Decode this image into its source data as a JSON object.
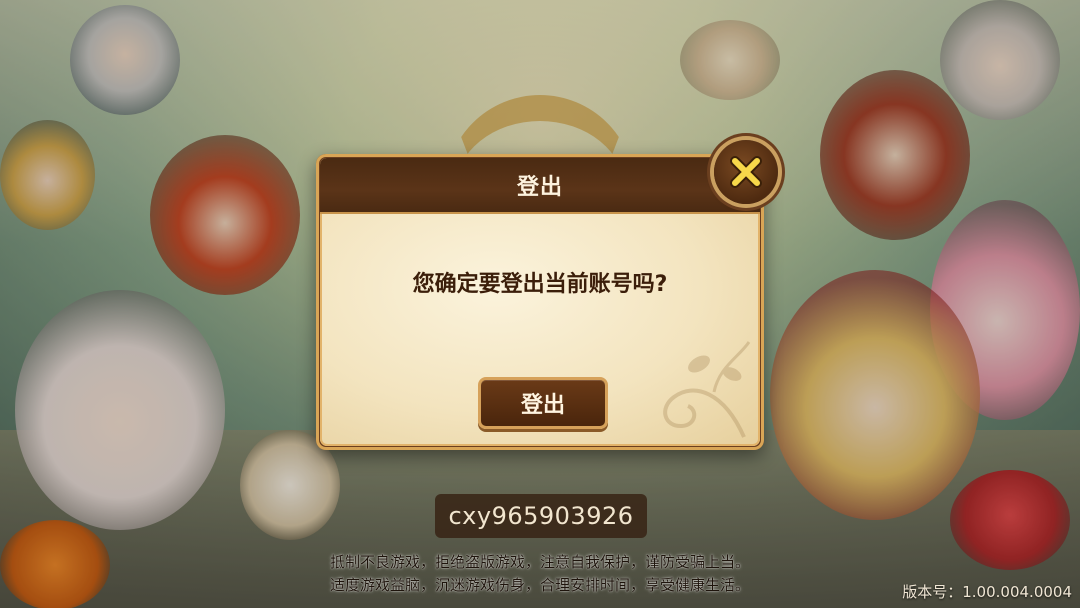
{
  "dialog": {
    "title": "登出",
    "message": "您确定要登出当前账号吗?",
    "confirm_label": "登出",
    "close_icon": "close-x-icon"
  },
  "account": {
    "username": "cxy965903926"
  },
  "footer": {
    "notice_line1": "抵制不良游戏，拒绝盗版游戏，注意自我保护，谨防受骗上当。",
    "notice_line2": "适度游戏益脑，沉迷游戏伤身，合理安排时间，享受健康生活。",
    "version": "版本号：1.00.004.0004"
  },
  "colors": {
    "dialog_frame": "#6b3f1f",
    "dialog_header": "#4a2a12",
    "dialog_body": "#f3e4bf",
    "close_x": "#f7d84a",
    "message_text": "#3b1e0a"
  }
}
